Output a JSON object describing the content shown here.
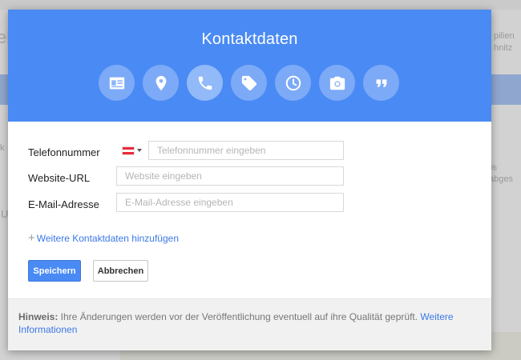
{
  "background": {
    "fragments": {
      "left_top": "el",
      "right_top_1": "pilien",
      "right_top_2": "hnitz",
      "left_mid": "k",
      "right_mid": "% abges",
      "left_low": "U"
    }
  },
  "modal": {
    "title": "Kontaktdaten",
    "icons": [
      {
        "name": "contact-card-icon",
        "active": false
      },
      {
        "name": "location-pin-icon",
        "active": false
      },
      {
        "name": "phone-icon",
        "active": true
      },
      {
        "name": "tag-icon",
        "active": false
      },
      {
        "name": "clock-icon",
        "active": false
      },
      {
        "name": "camera-icon",
        "active": false
      },
      {
        "name": "quote-icon",
        "active": false
      }
    ],
    "form": {
      "phone_label": "Telefonnummer",
      "phone_placeholder": "Telefonnummer eingeben",
      "website_label": "Website-URL",
      "website_placeholder": "Website eingeben",
      "email_label": "E-Mail-Adresse",
      "email_placeholder": "E-Mail-Adresse eingeben"
    },
    "add_more_label": "Weitere Kontaktdaten hinzufügen",
    "save_label": "Speichern",
    "cancel_label": "Abbrechen",
    "footer": {
      "hint_label": "Hinweis:",
      "hint_text": " Ihre Änderungen werden vor der Veröffentlichung eventuell auf ihre Qualität geprüft. ",
      "more_info_link": "Weitere Informationen"
    }
  },
  "colors": {
    "header_blue": "#4a8af4",
    "link_blue": "#3b78e7",
    "flag_red": "#ed2939"
  }
}
